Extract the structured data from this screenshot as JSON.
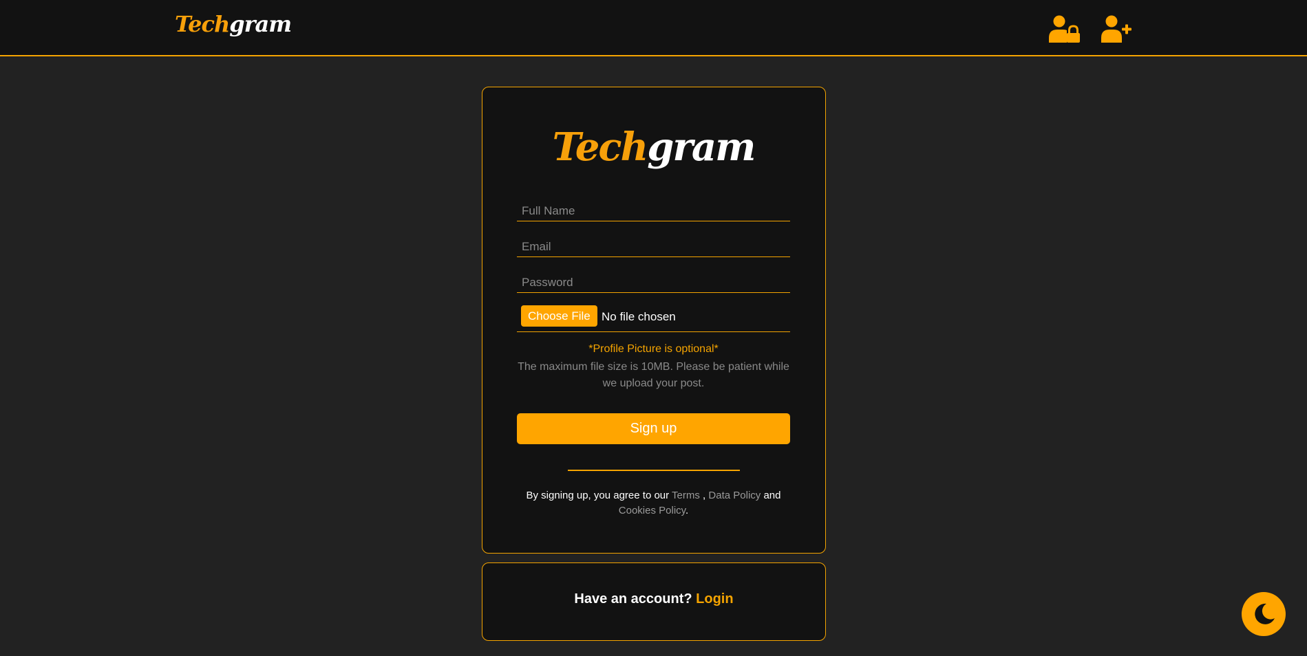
{
  "navbar": {
    "logo_part1": "Tech",
    "logo_part2": "gram",
    "icons": [
      "user-lock-icon",
      "user-plus-icon"
    ]
  },
  "signup_card": {
    "logo_part1": "Tech",
    "logo_part2": "gram",
    "full_name": {
      "value": "",
      "placeholder": "Full Name"
    },
    "email": {
      "value": "",
      "placeholder": "Email"
    },
    "password": {
      "value": "",
      "placeholder": "Password"
    },
    "file_input": {
      "button_label": "Choose File",
      "status": "No file chosen"
    },
    "optional_note": "*Profile Picture is optional*",
    "size_note": "The maximum file size is 10MB. Please be patient while we upload your post.",
    "submit_label": "Sign up",
    "terms": {
      "prefix": "By signing up, you agree to our",
      "terms_link": "Terms",
      "comma": " ,",
      "data_policy_link": "Data Policy",
      "and": "and",
      "cookies_link": "Cookies Policy",
      "period": "."
    }
  },
  "login_card": {
    "prompt": "Have an account?",
    "login_link": "Login"
  },
  "theme_toggle": {
    "icon": "moon-icon"
  },
  "colors": {
    "accent": "#ffa500",
    "background": "#222222",
    "card": "#121212",
    "muted_text": "#8a8a8a"
  }
}
